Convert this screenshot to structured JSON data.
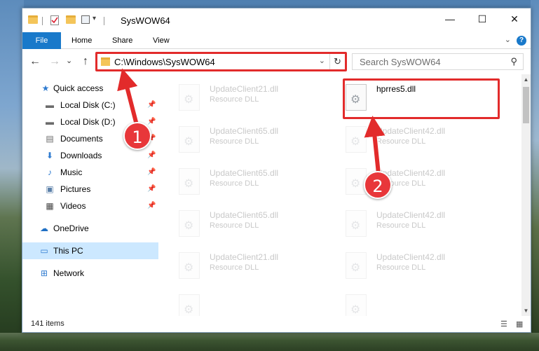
{
  "window": {
    "title": "SysWOW64",
    "minimize_glyph": "—",
    "maximize_glyph": "☐",
    "close_glyph": "✕"
  },
  "quick_access_toolbar": {
    "dropdown_glyph": "▾"
  },
  "ribbon": {
    "tabs": [
      "File",
      "Home",
      "Share",
      "View"
    ],
    "collapse_glyph": "⌄",
    "help_glyph": "?"
  },
  "nav": {
    "back_glyph": "←",
    "forward_glyph": "→",
    "recent_glyph": "⌄",
    "up_glyph": "↑",
    "address_path": "C:\\Windows\\SysWOW64",
    "address_dropdown_glyph": "⌄",
    "refresh_glyph": "↻",
    "search_placeholder": "Search SysWOW64",
    "search_glyph": "⚲"
  },
  "sidebar": {
    "items": [
      {
        "label": "Quick access",
        "icon": "star-icon",
        "glyph": "★",
        "color": "#2f7bd0",
        "pinned": false
      },
      {
        "label": "Local Disk (C:)",
        "icon": "drive-icon",
        "glyph": "▬",
        "color": "#6b6b6b",
        "pinned": true
      },
      {
        "label": "Local Disk (D:)",
        "icon": "drive-icon",
        "glyph": "▬",
        "color": "#6b6b6b",
        "pinned": true
      },
      {
        "label": "Documents",
        "icon": "documents-icon",
        "glyph": "▤",
        "color": "#6b6b6b",
        "pinned": true
      },
      {
        "label": "Downloads",
        "icon": "download-icon",
        "glyph": "⬇",
        "color": "#2f7bd0",
        "pinned": true
      },
      {
        "label": "Music",
        "icon": "music-icon",
        "glyph": "♪",
        "color": "#2f7bd0",
        "pinned": true
      },
      {
        "label": "Pictures",
        "icon": "pictures-icon",
        "glyph": "▣",
        "color": "#5a7fa8",
        "pinned": true
      },
      {
        "label": "Videos",
        "icon": "videos-icon",
        "glyph": "▦",
        "color": "#444",
        "pinned": true
      },
      {
        "label": "OneDrive",
        "icon": "cloud-icon",
        "glyph": "☁",
        "color": "#1f6fc4",
        "pinned": false
      },
      {
        "label": "This PC",
        "icon": "computer-icon",
        "glyph": "▭",
        "color": "#2f7bd0",
        "pinned": false
      },
      {
        "label": "Network",
        "icon": "network-icon",
        "glyph": "⊞",
        "color": "#2f7bd0",
        "pinned": false
      }
    ],
    "pin_glyph": "📌"
  },
  "files": [
    {
      "name": "UpdateClient21.dll",
      "type": "Resource DLL",
      "faded": true
    },
    {
      "name": "hprres5.dll",
      "type": "",
      "faded": false
    },
    {
      "name": "UpdateClient65.dll",
      "type": "Resource DLL",
      "faded": true
    },
    {
      "name": "UpdateClient42.dll",
      "type": "Resource DLL",
      "faded": true
    },
    {
      "name": "UpdateClient65.dll",
      "type": "Resource DLL",
      "faded": true
    },
    {
      "name": "UpdateClient42.dll",
      "type": "Resource DLL",
      "faded": true
    },
    {
      "name": "UpdateClient65.dll",
      "type": "Resource DLL",
      "faded": true
    },
    {
      "name": "UpdateClient42.dll",
      "type": "Resource DLL",
      "faded": true
    },
    {
      "name": "UpdateClient21.dll",
      "type": "Resource DLL",
      "faded": true
    },
    {
      "name": "UpdateClient42.dll",
      "type": "Resource DLL",
      "faded": true
    }
  ],
  "scrollbar": {
    "up_glyph": "▲",
    "down_glyph": "▼"
  },
  "status": {
    "item_count": "141 items",
    "details_view_glyph": "☰",
    "large_icons_glyph": "▦"
  },
  "annotations": {
    "step1": "1",
    "step2": "2",
    "color": "#e22b2b"
  }
}
